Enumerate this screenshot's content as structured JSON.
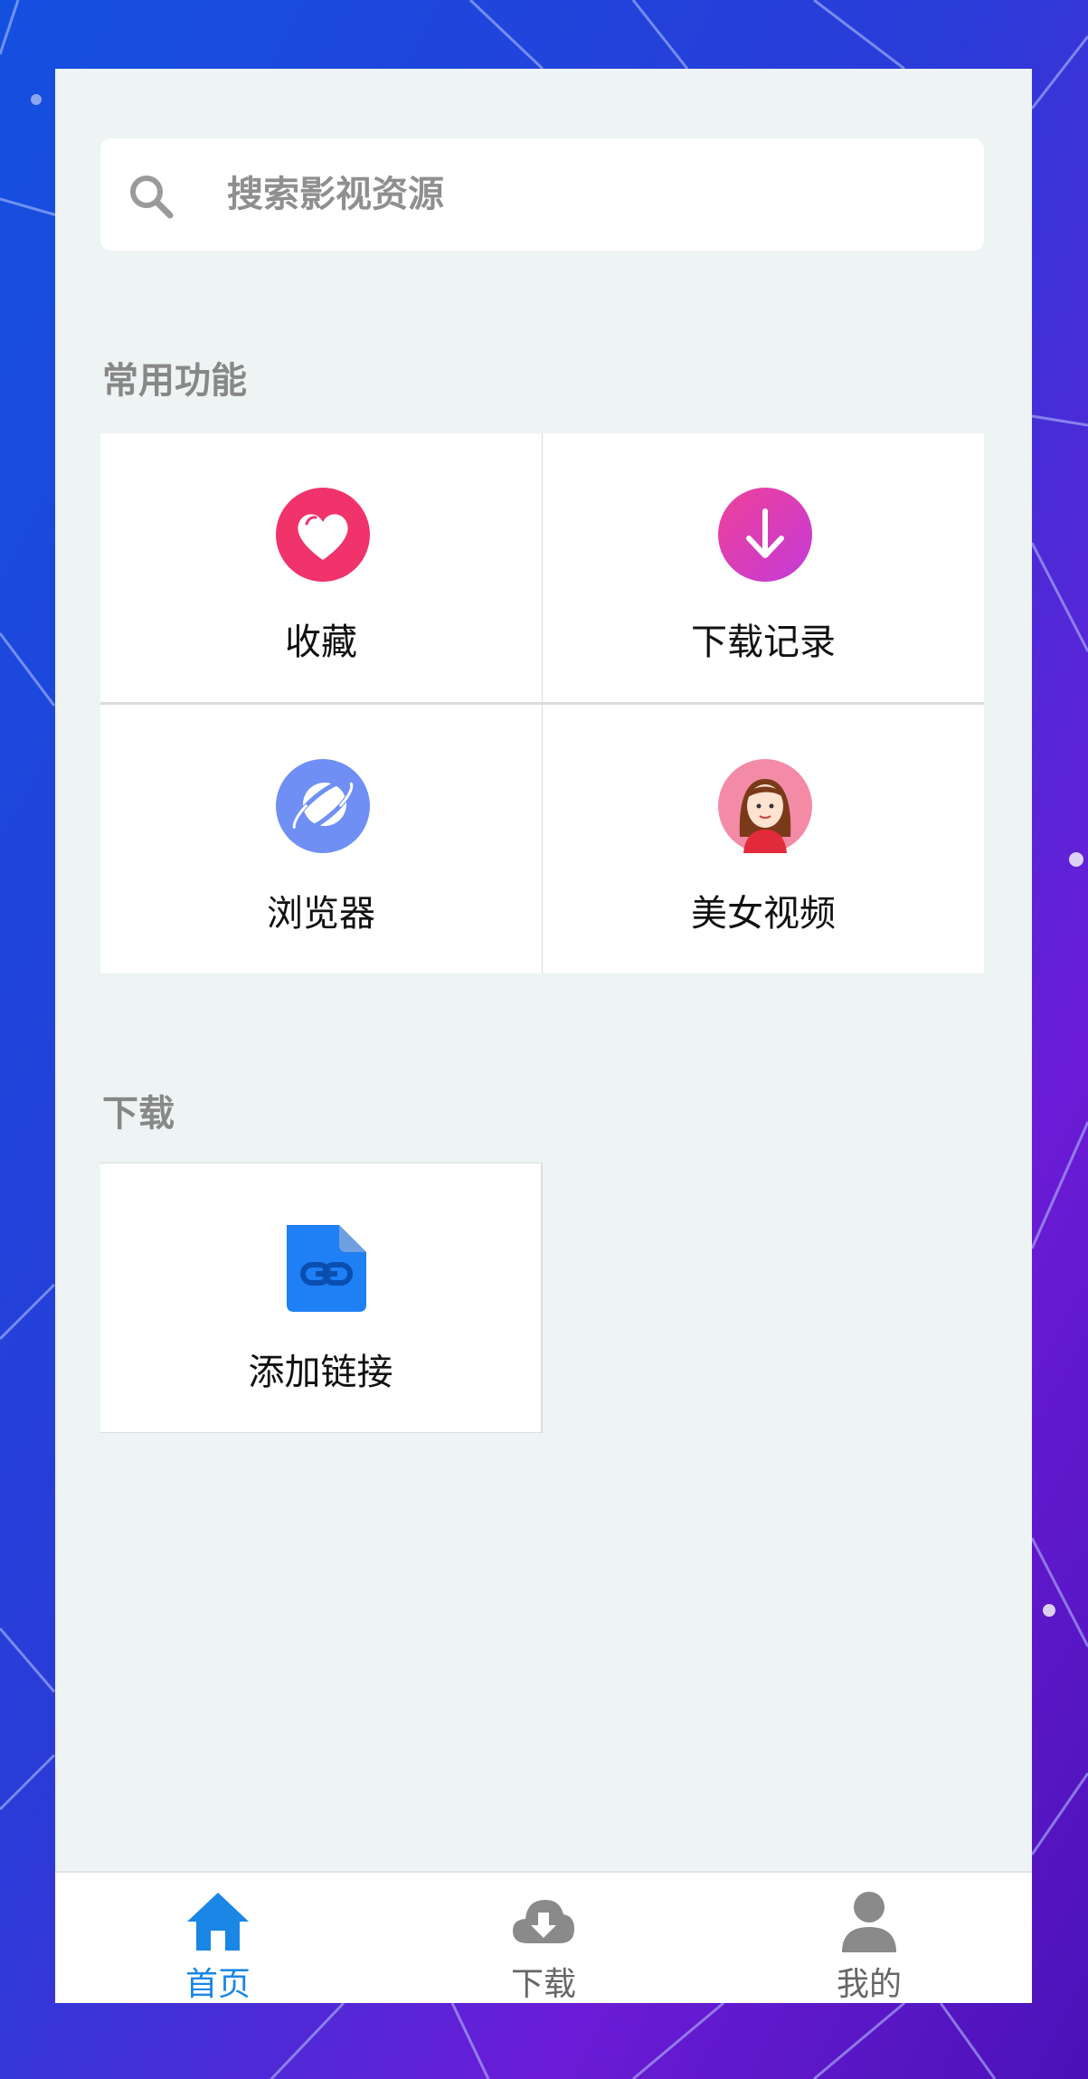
{
  "search": {
    "placeholder": "搜索影视资源"
  },
  "sections": {
    "common": {
      "title": "常用功能",
      "items": [
        {
          "label": "收藏",
          "icon": "heart-icon"
        },
        {
          "label": "下载记录",
          "icon": "download-arrow-icon"
        },
        {
          "label": "浏览器",
          "icon": "planet-icon"
        },
        {
          "label": "美女视频",
          "icon": "girl-avatar-icon"
        }
      ]
    },
    "download": {
      "title": "下载",
      "items": [
        {
          "label": "添加链接",
          "icon": "link-file-icon"
        }
      ]
    }
  },
  "nav": {
    "items": [
      {
        "label": "首页",
        "icon": "home-icon",
        "active": true
      },
      {
        "label": "下载",
        "icon": "cloud-download-icon",
        "active": false
      },
      {
        "label": "我的",
        "icon": "user-icon",
        "active": false
      }
    ]
  },
  "colors": {
    "accent": "#1a86e6",
    "heart": "#f0336a",
    "download_grad_start": "#ee4199",
    "download_grad_end": "#c43ad8",
    "planet": "#6f8ff5",
    "avatar_bg": "#f38ba6",
    "link_file": "#1f7ff5"
  }
}
